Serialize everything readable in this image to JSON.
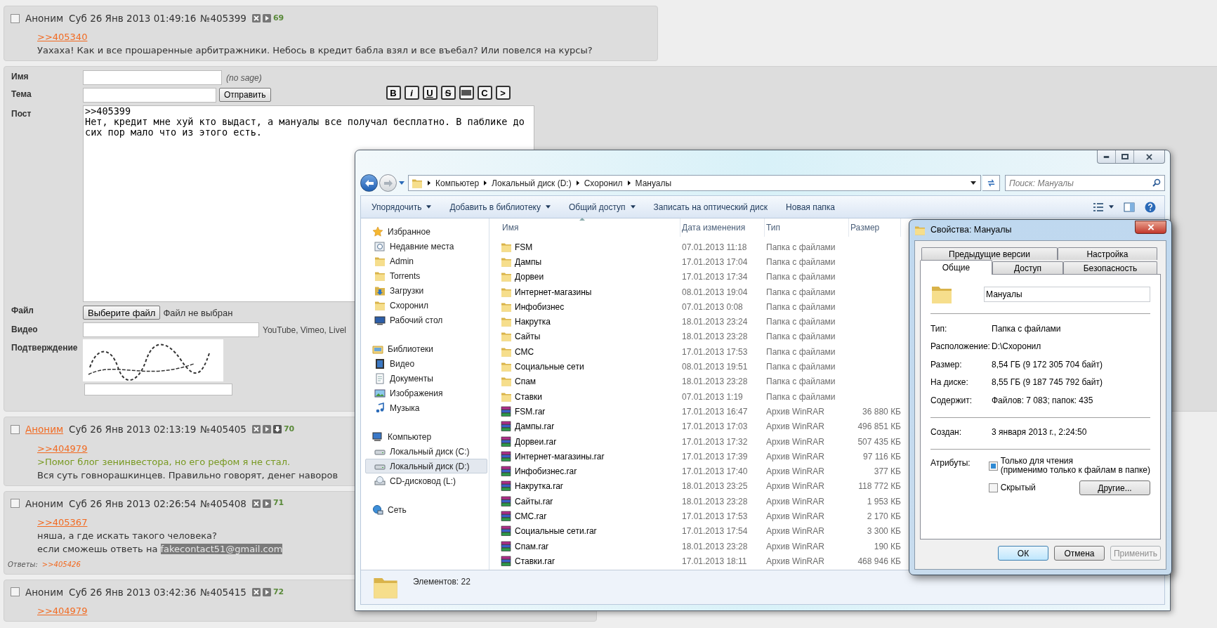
{
  "posts": [
    {
      "checked": false,
      "author": "Аноним",
      "author_link": false,
      "date": "Суб 26 Янв 2013 01:49:16",
      "number": "№405399",
      "download_button": false,
      "count": "69",
      "reply_to": ">>405340",
      "lines": [
        {
          "kind": "plain",
          "text": "Уахаха! Как и все прошаренные арбитражники. Небось в кредит бабла взял и все въебал? Или повелся на курсы?"
        }
      ]
    }
  ],
  "form": {
    "name": {
      "label": "Имя",
      "note": "(no sage)"
    },
    "subject": {
      "label": "Тема",
      "submit": "Отправить"
    },
    "markup_buttons": [
      {
        "kind": "bold",
        "label": "B"
      },
      {
        "kind": "italic",
        "label": "i"
      },
      {
        "kind": "underline",
        "label": "U"
      },
      {
        "kind": "strike",
        "label": "S"
      },
      {
        "kind": "spoiler"
      },
      {
        "kind": "code",
        "label": "C"
      },
      {
        "kind": "quote",
        "label": ">"
      }
    ],
    "post": {
      "label": "Пост",
      "value": ">>405399\nНет, кредит мне хуй кто выдаст, а мануалы все получал бесплатно. В паблике до сих пор мало что из этого есть."
    },
    "file": {
      "label": "Файл",
      "button": "Выберите файл",
      "status": "Файл не выбран"
    },
    "video": {
      "label": "Видео",
      "hint": "YouTube, Vimeo, Livel"
    },
    "captcha": {
      "label": "Подтверждение"
    }
  },
  "posts_below": [
    {
      "checked": false,
      "author": "Аноним",
      "author_link": true,
      "date": "Суб 26 Янв 2013 02:13:19",
      "number": "№405405",
      "download_button": true,
      "count": "70",
      "reply_to": ">>404979",
      "lines": [
        {
          "kind": "quote",
          "text": ">Помог блог зенинвестора, но его рефом я не стал."
        },
        {
          "kind": "plain",
          "text": "Вся суть говнорашкинцев. Правильно говорят, денег наворов"
        }
      ]
    },
    {
      "checked": false,
      "author": "Аноним",
      "author_link": false,
      "date": "Суб 26 Янв 2013 02:26:54",
      "number": "№405408",
      "download_button": false,
      "count": "71",
      "reply_to": ">>405367",
      "lines": [
        {
          "kind": "plain",
          "text": "няша, а где искать такого человека?"
        },
        {
          "kind": "plain",
          "text": "если сможешь ответь на ",
          "highlight": "fakecontact51@gmail.com"
        }
      ],
      "replies_label": "Ответы:",
      "replies": [
        ">>405426"
      ]
    },
    {
      "checked": false,
      "author": "Аноним",
      "author_link": false,
      "date": "Суб 26 Янв 2013 03:42:36",
      "number": "№405415",
      "download_button": false,
      "count": "72",
      "reply_to": ">>404979"
    }
  ],
  "explorer": {
    "breadcrumb": [
      "Компьютер",
      "Локальный диск (D:)",
      "Схоронил",
      "Мануалы"
    ],
    "search": {
      "placeholder": "Поиск: Мануалы"
    },
    "toolbar": [
      {
        "label": "Упорядочить",
        "dropdown": true
      },
      {
        "label": "Добавить в библиотеку",
        "dropdown": true
      },
      {
        "label": "Общий доступ",
        "dropdown": true
      },
      {
        "label": "Записать на оптический диск",
        "dropdown": false
      },
      {
        "label": "Новая папка",
        "dropdown": false
      }
    ],
    "nav": [
      {
        "label": "Избранное",
        "kind": "favorites",
        "children": [
          {
            "label": "Недавние места",
            "kind": "recent",
            "selected": false
          },
          {
            "label": "Admin",
            "kind": "folder",
            "selected": false
          },
          {
            "label": "Torrents",
            "kind": "folder",
            "selected": false
          },
          {
            "label": "Загрузки",
            "kind": "downloads",
            "selected": false
          },
          {
            "label": "Схоронил",
            "kind": "folder",
            "selected": false
          },
          {
            "label": "Рабочий стол",
            "kind": "desktop",
            "selected": false
          }
        ]
      },
      {
        "label": "Библиотеки",
        "kind": "libraries",
        "children": [
          {
            "label": "Видео",
            "kind": "video",
            "selected": false
          },
          {
            "label": "Документы",
            "kind": "documents",
            "selected": false
          },
          {
            "label": "Изображения",
            "kind": "pictures",
            "selected": false
          },
          {
            "label": "Музыка",
            "kind": "music",
            "selected": false
          }
        ]
      },
      {
        "label": "Компьютер",
        "kind": "computer",
        "children": [
          {
            "label": "Локальный диск (C:)",
            "kind": "drive",
            "selected": false
          },
          {
            "label": "Локальный диск (D:)",
            "kind": "drive",
            "selected": true
          },
          {
            "label": "CD-дисковод (L:)",
            "kind": "cd",
            "selected": false
          }
        ]
      },
      {
        "label": "Сеть",
        "kind": "network"
      }
    ],
    "columns": [
      "Имя",
      "Дата изменения",
      "Тип",
      "Размер"
    ],
    "rows": [
      {
        "kind": "folder",
        "name": "FSM",
        "date": "07.01.2013 11:18",
        "type": "Папка с файлами"
      },
      {
        "kind": "folder",
        "name": "Дампы",
        "date": "17.01.2013 17:04",
        "type": "Папка с файлами"
      },
      {
        "kind": "folder",
        "name": "Дорвеи",
        "date": "17.01.2013 17:34",
        "type": "Папка с файлами"
      },
      {
        "kind": "folder",
        "name": "Интернет-магазины",
        "date": "08.01.2013 19:04",
        "type": "Папка с файлами"
      },
      {
        "kind": "folder",
        "name": "Инфобизнес",
        "date": "07.01.2013 0:08",
        "type": "Папка с файлами"
      },
      {
        "kind": "folder",
        "name": "Накрутка",
        "date": "18.01.2013 23:24",
        "type": "Папка с файлами"
      },
      {
        "kind": "folder",
        "name": "Сайты",
        "date": "18.01.2013 23:28",
        "type": "Папка с файлами"
      },
      {
        "kind": "folder",
        "name": "СМС",
        "date": "17.01.2013 17:53",
        "type": "Папка с файлами"
      },
      {
        "kind": "folder",
        "name": "Социальные сети",
        "date": "08.01.2013 19:51",
        "type": "Папка с файлами"
      },
      {
        "kind": "folder",
        "name": "Спам",
        "date": "18.01.2013 23:28",
        "type": "Папка с файлами"
      },
      {
        "kind": "folder",
        "name": "Ставки",
        "date": "07.01.2013 1:19",
        "type": "Папка с файлами"
      },
      {
        "kind": "archive",
        "name": "FSM.rar",
        "date": "17.01.2013 16:47",
        "type": "Архив WinRAR",
        "size": "36 880 КБ"
      },
      {
        "kind": "archive",
        "name": "Дампы.rar",
        "date": "17.01.2013 17:03",
        "type": "Архив WinRAR",
        "size": "496 851 КБ"
      },
      {
        "kind": "archive",
        "name": "Дорвеи.rar",
        "date": "17.01.2013 17:32",
        "type": "Архив WinRAR",
        "size": "507 435 КБ"
      },
      {
        "kind": "archive",
        "name": "Интернет-магазины.rar",
        "date": "17.01.2013 17:39",
        "type": "Архив WinRAR",
        "size": "97 116 КБ"
      },
      {
        "kind": "archive",
        "name": "Инфобизнес.rar",
        "date": "17.01.2013 17:40",
        "type": "Архив WinRAR",
        "size": "377 КБ"
      },
      {
        "kind": "archive",
        "name": "Накрутка.rar",
        "date": "18.01.2013 23:25",
        "type": "Архив WinRAR",
        "size": "118 772 КБ"
      },
      {
        "kind": "archive",
        "name": "Сайты.rar",
        "date": "18.01.2013 23:28",
        "type": "Архив WinRAR",
        "size": "1 953 КБ"
      },
      {
        "kind": "archive",
        "name": "СМС.rar",
        "date": "17.01.2013 17:53",
        "type": "Архив WinRAR",
        "size": "2 170 КБ"
      },
      {
        "kind": "archive",
        "name": "Социальные сети.rar",
        "date": "17.01.2013 17:54",
        "type": "Архив WinRAR",
        "size": "3 300 КБ"
      },
      {
        "kind": "archive",
        "name": "Спам.rar",
        "date": "18.01.2013 23:28",
        "type": "Архив WinRAR",
        "size": "190 КБ"
      },
      {
        "kind": "archive",
        "name": "Ставки.rar",
        "date": "17.01.2013 18:11",
        "type": "Архив WinRAR",
        "size": "468 946 КБ"
      }
    ],
    "status": "Элементов: 22"
  },
  "properties": {
    "title": "Свойства: Мануалы",
    "tabs_back": [
      {
        "label": "Предыдущие версии",
        "selected": false
      },
      {
        "label": "Настройка",
        "selected": false
      }
    ],
    "tabs_front": [
      {
        "label": "Общие",
        "selected": true
      },
      {
        "label": "Доступ",
        "selected": false
      },
      {
        "label": "Безопасность",
        "selected": false
      }
    ],
    "name_value": "Мануалы",
    "sections": [
      [
        {
          "label": "Тип:",
          "value": "Папка с файлами"
        },
        {
          "label": "Расположение:",
          "value": "D:\\Схоронил"
        },
        {
          "label": "Размер:",
          "value": "8,54 ГБ (9 172 305 704 байт)"
        },
        {
          "label": "На диске:",
          "value": "8,55 ГБ (9 187 745 792 байт)"
        },
        {
          "label": "Содержит:",
          "value": "Файлов: 7 083; папок: 435"
        }
      ],
      [
        {
          "label": "Создан:",
          "value": "3 января 2013 г., 2:24:50"
        }
      ]
    ],
    "attributes": {
      "label": "Атрибуты:",
      "options": [
        {
          "label": "Только для чтения",
          "note": "(применимо только к файлам в папке)",
          "checked": false,
          "mixed": true
        },
        {
          "label": "Скрытый",
          "checked": false,
          "mixed": false
        }
      ],
      "button": "Другие..."
    },
    "buttons": [
      {
        "label": "ОК",
        "default": true,
        "disabled": false
      },
      {
        "label": "Отмена",
        "default": false,
        "disabled": false
      },
      {
        "label": "Применить",
        "default": false,
        "disabled": true
      }
    ]
  }
}
